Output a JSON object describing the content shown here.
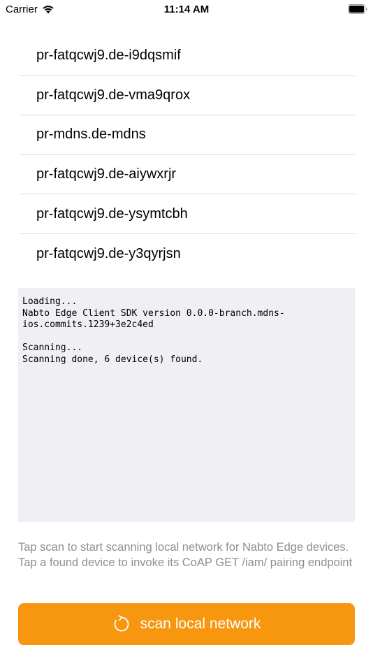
{
  "status_bar": {
    "carrier": "Carrier",
    "time": "11:14 AM"
  },
  "devices": [
    "pr-fatqcwj9.de-i9dqsmif",
    "pr-fatqcwj9.de-vma9qrox",
    "pr-mdns.de-mdns",
    "pr-fatqcwj9.de-aiywxrjr",
    "pr-fatqcwj9.de-ysymtcbh",
    "pr-fatqcwj9.de-y3qyrjsn"
  ],
  "log": {
    "text": "Loading...\nNabto Edge Client SDK version 0.0.0-branch.mdns-\nios.commits.1239+3e2c4ed\n\nScanning...\nScanning done, 6 device(s) found."
  },
  "help": {
    "text": "Tap scan to start scanning local network for Nabto Edge devices. Tap a found device to invoke its CoAP GET /iam/ pairing endpoint"
  },
  "scan_button": {
    "label": "scan local network",
    "icon": "refresh-icon"
  },
  "colors": {
    "accent": "#f7960f",
    "log_background": "#efeff4",
    "help_text": "#8e8e93"
  }
}
